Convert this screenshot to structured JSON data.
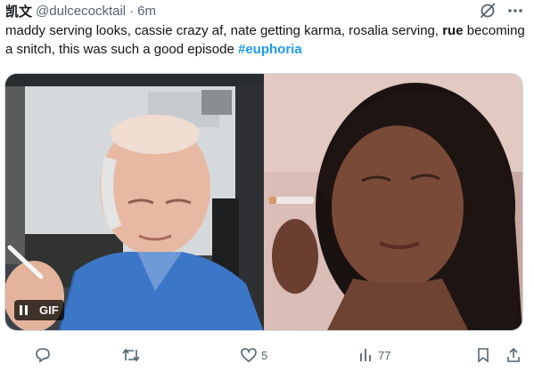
{
  "tweet": {
    "display_name": "凯文",
    "handle": "@dulcecocktail",
    "separator": "·",
    "time": "6m",
    "text_part1": "maddy serving looks, cassie crazy af, nate getting karma, rosalia serving, ",
    "text_bold": "rue",
    "text_part2": " becoming a snitch, this was such a good episode ",
    "hashtag": "#euphoria"
  },
  "media": {
    "gif_label": "GIF",
    "pause_icon": "pause-icon"
  },
  "actions": {
    "reply_count": "",
    "retweet_count": "",
    "like_count": "5",
    "views_count": "77"
  },
  "colors": {
    "text": "#0f1419",
    "secondary": "#536471",
    "accent": "#1d9bf0",
    "border": "#cfd9de"
  }
}
